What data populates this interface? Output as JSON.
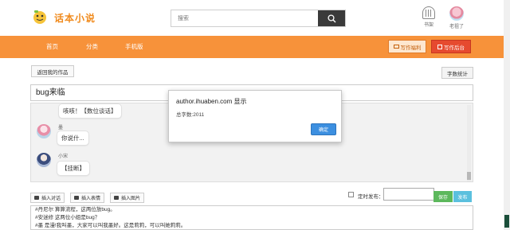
{
  "header": {
    "logo_text": "话本小说",
    "search_placeholder": "搜索",
    "shelf_label": "书架",
    "user_label": "老祖了"
  },
  "nav": {
    "items": [
      "首页",
      "分类",
      "手机版"
    ],
    "manuscript_btn": "写作福利",
    "backend_btn": "写作后台"
  },
  "toolbar_top": {
    "return_label": "返回我的作品",
    "wordcount_label": "字数统计"
  },
  "work": {
    "title": "bug来临"
  },
  "chat": {
    "messages": [
      {
        "speaker": "",
        "text": "咳咳！【数位谈话】"
      },
      {
        "speaker": "墨",
        "text": "你说什..."
      },
      {
        "speaker": "小宋",
        "text": "【挂断】"
      }
    ]
  },
  "dialog": {
    "title": "author.ihuaben.com 显示",
    "message": "总字数:2011",
    "ok_label": "确定"
  },
  "toolbar_bottom": {
    "insert_dialog": "插入对话",
    "insert_emoji": "插入表情",
    "insert_image": "插入图片",
    "schedule_label": "定时发布：",
    "save_label": "保存",
    "publish_label": "发布"
  },
  "editor": {
    "lines": [
      "#丹尼尔 算算流程，这两位放bug。",
      "#安迷修 这两位小姐是bug？",
      "#墨 是漫!我叫墨，大家可以叫我墨好。这是莉莉，可以叫她莉莉。"
    ]
  },
  "colors": {
    "nav_orange": "#f7923a",
    "save_green": "#5cb85c",
    "publish_blue": "#5bc0de",
    "ok_blue": "#3c8fe0"
  }
}
